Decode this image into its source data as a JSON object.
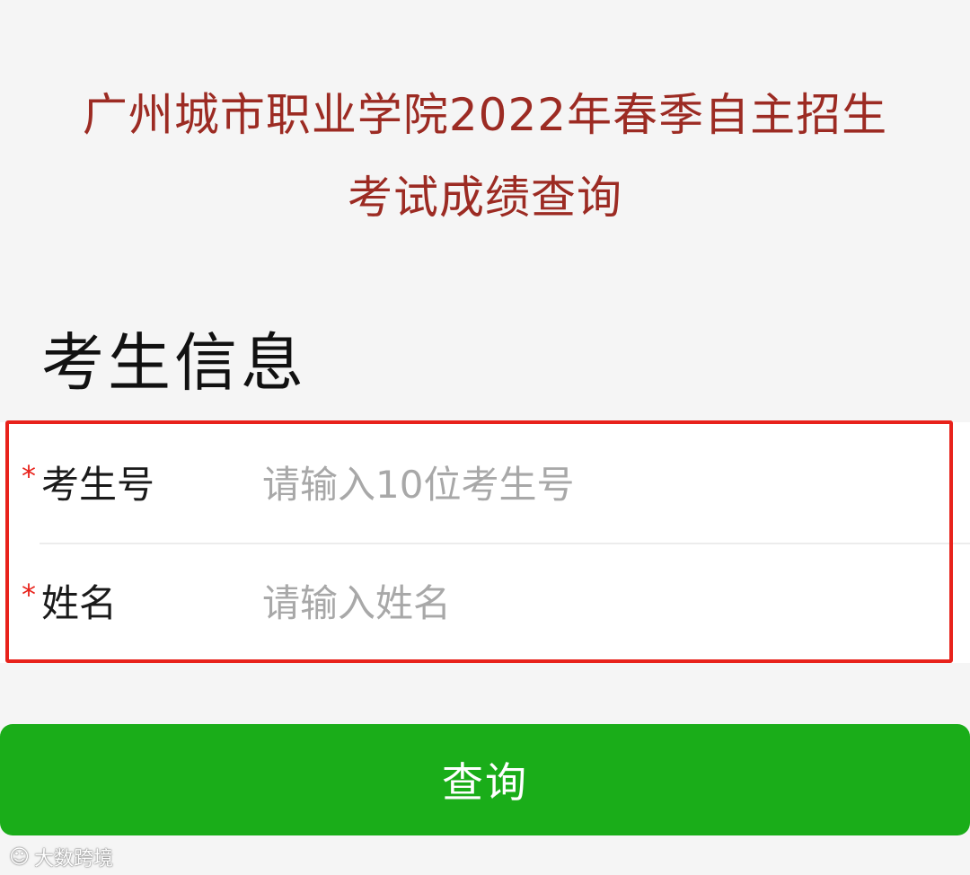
{
  "header": {
    "title_line1": "广州城市职业学院2022年春季自主招生",
    "title_line2": "考试成绩查询"
  },
  "section": {
    "heading": "考生信息"
  },
  "form": {
    "required_mark": "*",
    "fields": [
      {
        "label": "考生号",
        "placeholder": "请输入10位考生号",
        "value": ""
      },
      {
        "label": "姓名",
        "placeholder": "请输入姓名",
        "value": ""
      }
    ],
    "submit_label": "查询"
  },
  "watermark": {
    "logo": "☺︎",
    "text": "大数跨境"
  },
  "colors": {
    "title": "#9c2b23",
    "required": "#e8221b",
    "highlight_border": "#e8221b",
    "button_bg": "#1aad19",
    "page_bg": "#f5f5f5"
  }
}
